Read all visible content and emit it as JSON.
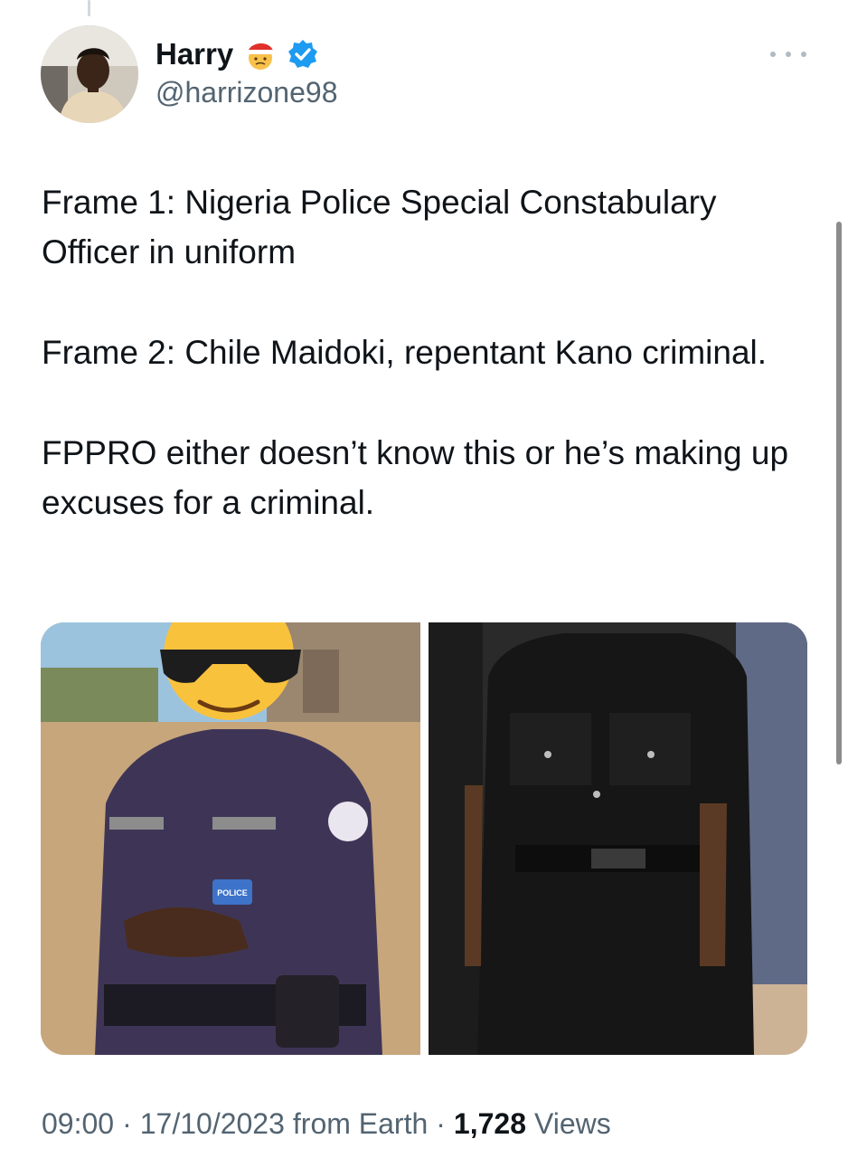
{
  "author": {
    "display_name": "Harry",
    "handle": "@harrizone98",
    "status_emoji": "santa-face-emoji",
    "verified_icon": "verified-badge-icon",
    "verified_color": "#1d9bf0"
  },
  "tweet": {
    "paragraphs": [
      "Frame 1: Nigeria Police Special Constabulary Officer in uniform",
      "Frame 2: Chile Maidoki, repentant Kano criminal.",
      "FPPRO either doesn’t know this or he’s making up excuses for a criminal."
    ],
    "images": [
      {
        "icon": "police-officer-photo-with-sunglasses-emoji",
        "badge_text": "POLICE"
      },
      {
        "icon": "black-uniform-photo"
      }
    ]
  },
  "meta": {
    "time": "09:00",
    "date": "17/10/2023",
    "source": "from Earth",
    "separator": "·",
    "views_count": "1,728",
    "views_label": "Views"
  },
  "colors": {
    "text": "#0f1419",
    "secondary": "#536471",
    "accent": "#1d9bf0"
  }
}
